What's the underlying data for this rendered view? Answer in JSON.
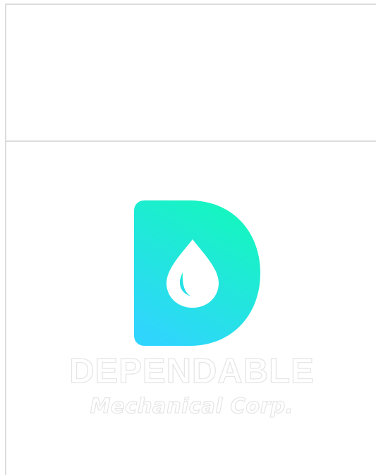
{
  "brand": {
    "name": "DEPENDABLE",
    "tagline": "Mechanical Corp.",
    "logo_icon": "water-drop-d-monogram",
    "colors": {
      "gradient_top": "#14f7bd",
      "gradient_bottom": "#30d5fd",
      "drop": "#ffffff",
      "outline": "#e3e3e3",
      "frame_border": "#dcdcdc"
    }
  }
}
